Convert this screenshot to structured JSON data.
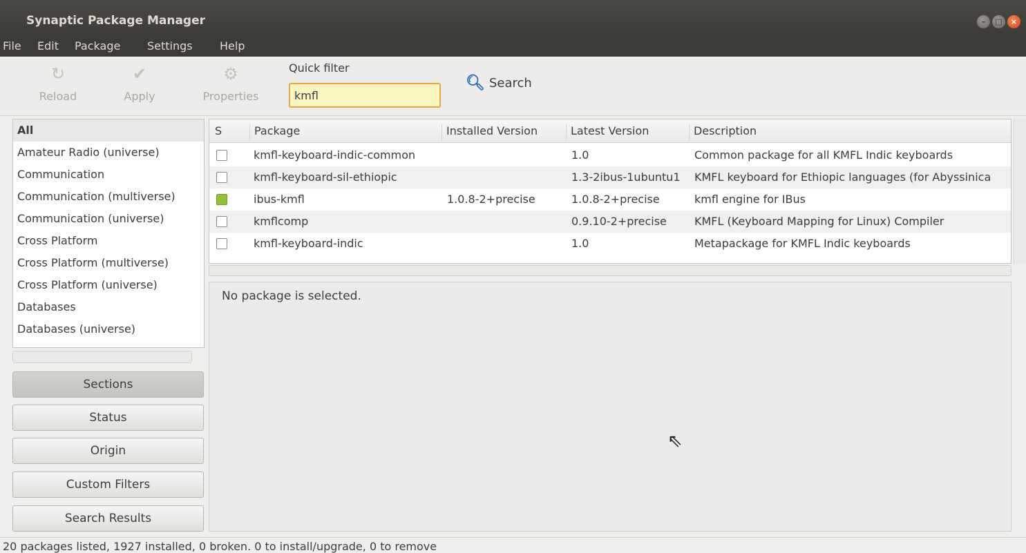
{
  "window": {
    "title": "Synaptic Package Manager",
    "buttons": [
      "–",
      "□",
      "×"
    ]
  },
  "menu": [
    "File",
    "Edit",
    "Package",
    "Settings",
    "Help"
  ],
  "toolbar": {
    "reload": "Reload",
    "apply": "Apply",
    "properties": "Properties",
    "quick_filter_label": "Quick filter",
    "quick_filter_value": "kmfl",
    "search": "Search"
  },
  "sections": [
    "All",
    "Amateur Radio (universe)",
    "Communication",
    "Communication (multiverse)",
    "Communication (universe)",
    "Cross Platform",
    "Cross Platform (multiverse)",
    "Cross Platform (universe)",
    "Databases",
    "Databases (universe)"
  ],
  "filter_buttons": [
    "Sections",
    "Status",
    "Origin",
    "Custom Filters",
    "Search Results"
  ],
  "table": {
    "headers": [
      "S",
      "Package",
      "Installed Version",
      "Latest Version",
      "Description"
    ],
    "rows": [
      {
        "status": "not-installed",
        "package": "kmfl-keyboard-indic-common",
        "installed": "",
        "latest": "1.0",
        "description": "Common package for all KMFL Indic keyboards"
      },
      {
        "status": "not-installed",
        "package": "kmfl-keyboard-sil-ethiopic",
        "installed": "",
        "latest": "1.3-2ibus-1ubuntu1",
        "description": "KMFL keyboard for Ethiopic languages (for Abyssinica"
      },
      {
        "status": "installed",
        "package": "ibus-kmfl",
        "installed": "1.0.8-2+precise",
        "latest": "1.0.8-2+precise",
        "description": "kmfl engine for IBus"
      },
      {
        "status": "not-installed",
        "package": "kmflcomp",
        "installed": "",
        "latest": "0.9.10-2+precise",
        "description": "KMFL (Keyboard Mapping for Linux) Compiler"
      },
      {
        "status": "not-installed",
        "package": "kmfl-keyboard-indic",
        "installed": "",
        "latest": "1.0",
        "description": "Metapackage for KMFL Indic keyboards"
      }
    ]
  },
  "detail_text": "No package is selected.",
  "status_text": "20 packages listed, 1927 installed, 0 broken. 0 to install/upgrade, 0 to remove"
}
